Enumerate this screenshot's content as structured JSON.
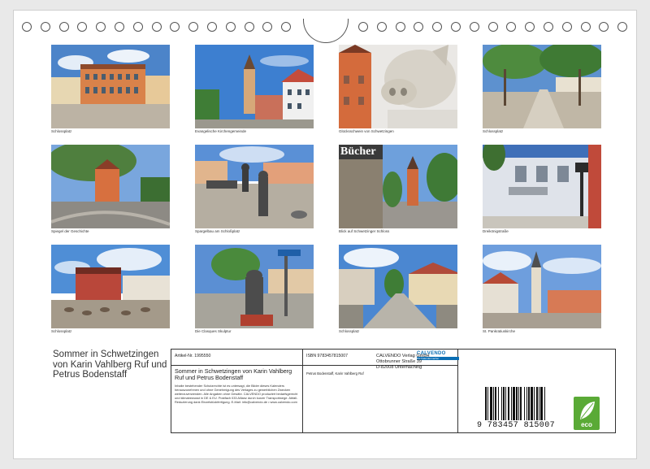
{
  "photos": [
    {
      "caption": "Schlossplatz"
    },
    {
      "caption": "Evangelische Kirchengemeinde"
    },
    {
      "caption": "Glücksschwein von Schwetzingen",
      "sign": ""
    },
    {
      "caption": "Schlossplatz"
    },
    {
      "caption": "Spiegel der Geschichte"
    },
    {
      "caption": "Spargelbau am Schloßplatz"
    },
    {
      "caption": "Blick auf Schwetzinger Schloss",
      "sign": "Bücher"
    },
    {
      "caption": "Dreikönigstraße"
    },
    {
      "caption": "Schlossplatz"
    },
    {
      "caption": "Die Clasques Skulptur"
    },
    {
      "caption": "Schlossplatz"
    },
    {
      "caption": "St. Pankratiuskirche"
    }
  ],
  "title": "Sommer in Schwetzingen von Karin Vahlberg Ruf und Petrus Bodenstaff",
  "info": {
    "article": "Artikel-Nr. 1995550",
    "logo": "CALVENDO",
    "logo_tag": "Die Kalendermacher",
    "subtitle": "Sommer in Schwetzingen von Karin Vahlberg Ruf und Petrus Bodenstaff",
    "legal": "Inhalte bestehender Schutzrechte ist es untersagt, die Bilder dieses Kalenders herauszunehmen und ohne Genehmigung des Verlages zu gewerblichen Zwecken weiterzuverwenden. Alle Angaben ohne Gewähr. CALVENDO produziert bedarfsgerecht und klimabewusst in DE & EU. Postfach 033 Allianz durch kurzer Transportwege. Abfall-Reduzierung dank Einzelstückfertigung. E-Mail: info@calvendo.de • www.calvendo.com",
    "isbn": "ISBN 9783457815007",
    "authors": "Petrus Bodenstaff, Karin Vahlberg Ruf",
    "publisher": "CALVENDO Verlag GmbH",
    "street": "Ottobrunner Straße 39",
    "city": "D-82008 Unterhaching"
  },
  "barcode": {
    "digits": "9 783457 815007"
  },
  "eco": {
    "label": "eco"
  }
}
